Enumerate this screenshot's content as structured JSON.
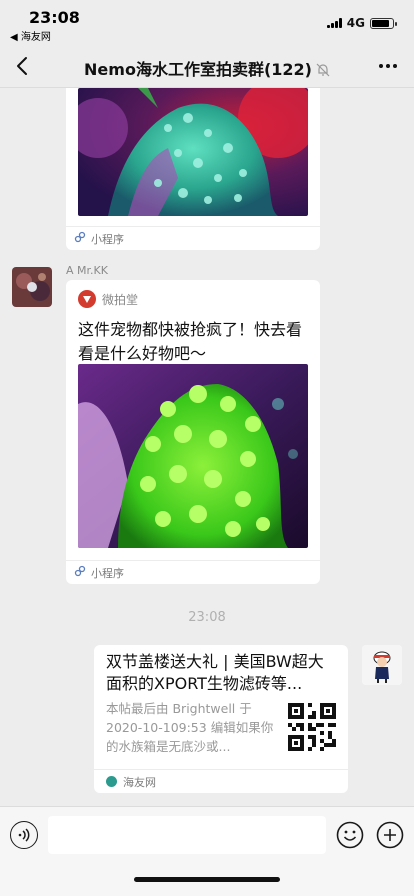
{
  "status_bar": {
    "time": "23:08",
    "back_app": "◀ 海友网",
    "network": "4G",
    "battery_level": 0.85
  },
  "nav": {
    "title": "Nemo海水工作室拍卖群(122)",
    "icons": [
      "back-chevron-icon",
      "mute-bell-icon",
      "more-dots-icon"
    ]
  },
  "messages": {
    "first_card": {
      "footer_label": "小程序"
    },
    "second": {
      "sender_name": "A  Mr.KK",
      "app_name": "微拍堂",
      "text": "这件宠物都快被抢疯了！快去看看是什么好物吧～",
      "footer_label": "小程序"
    },
    "timestamp": "23:08",
    "link_card": {
      "title": "双节盖楼送大礼 | 美国BW超大面积的XPORT生物滤砖等...",
      "description": "本帖最后由 Brightwell 于 2020-10-109:53 编辑如果你的水族箱是无底沙或...",
      "source": "海友网"
    }
  },
  "input_bar": {
    "icons": [
      "voice-icon",
      "emoji-icon",
      "plus-icon"
    ]
  },
  "colors": {
    "background": "#ededed",
    "bubble": "#ffffff",
    "accent_red": "#d23b2e"
  }
}
